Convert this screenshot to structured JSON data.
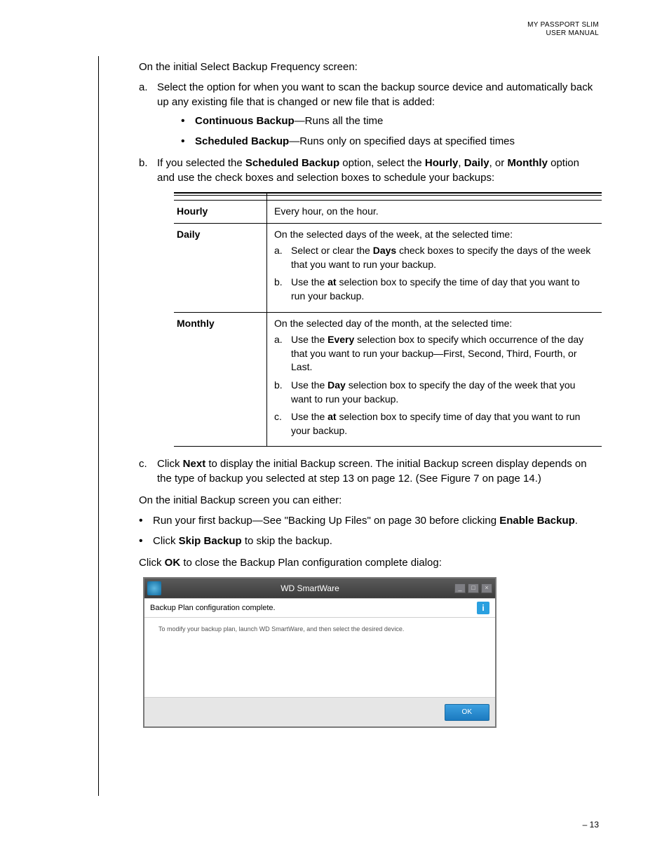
{
  "header": {
    "line1": "MY PASSPORT SLIM",
    "line2": "USER MANUAL"
  },
  "intro": "On the initial Select Backup Frequency screen:",
  "step_a": {
    "label": "a.",
    "text": "Select the option for when you want to scan the backup source device and automatically back up any existing file that is changed or new file that is added:",
    "bullets": [
      {
        "bold": "Continuous Backup",
        "rest": "—Runs all the time"
      },
      {
        "bold": "Scheduled Backup",
        "rest": "—Runs only on specified days at specified times"
      }
    ]
  },
  "step_b": {
    "label": "b.",
    "pre": "If you selected the ",
    "b1": "Scheduled Backup",
    "mid1": " option, select the ",
    "b2": "Hourly",
    "sep1": ", ",
    "b3": "Daily",
    "sep2": ", or ",
    "b4": "Monthly",
    "post": " option and use the check boxes and selection boxes to schedule your backups:"
  },
  "table": {
    "hourly": {
      "label": "Hourly",
      "desc": "Every hour, on the hour."
    },
    "daily": {
      "label": "Daily",
      "intro": "On the selected days of the week, at the selected time:",
      "a": {
        "label": "a.",
        "pre": "Select or clear the ",
        "b": "Days",
        "post": " check boxes to specify the days of the week that you want to run your backup."
      },
      "b": {
        "label": "b.",
        "pre": "Use the ",
        "b": "at",
        "post": " selection box to specify the time of day that you want to run your backup."
      }
    },
    "monthly": {
      "label": "Monthly",
      "intro": "On the selected day of the month, at the selected time:",
      "a": {
        "label": "a.",
        "pre": "Use the ",
        "b": "Every",
        "post": " selection box to specify which occurrence of the day that you want to run your backup—First, Second, Third, Fourth, or Last."
      },
      "b": {
        "label": "b.",
        "pre": "Use the ",
        "b": "Day",
        "post": " selection box to specify the day of the week that you want to run your backup."
      },
      "c": {
        "label": "c.",
        "pre": "Use the ",
        "b": "at",
        "post": " selection box to specify time of day that you want to run your backup."
      }
    }
  },
  "step_c": {
    "label": "c.",
    "pre": "Click ",
    "b1": "Next",
    "post": " to display the initial Backup screen. The initial Backup screen display depends on the type of backup you selected at step 13 on page 12. (See Figure 7 on page 14.)"
  },
  "post_intro": "On the initial Backup screen you can either:",
  "post_bullets": {
    "b1": {
      "pre": "Run your first backup—See \"Backing Up Files\" on page 30 before clicking ",
      "bold": "Enable Backup",
      "post": "."
    },
    "b2": {
      "pre": "Click ",
      "bold": "Skip Backup",
      "post": " to skip the backup."
    }
  },
  "close_line": {
    "pre": "Click ",
    "b": "OK",
    "post": " to close the Backup Plan configuration complete dialog:"
  },
  "dialog": {
    "title": "WD SmartWare",
    "message": "Backup Plan configuration complete.",
    "subtext": "To modify your backup plan, launch WD SmartWare, and then select the desired device.",
    "ok": "OK",
    "info": "i",
    "min": "_",
    "max": "□",
    "close": "×"
  },
  "page_number": "– 13"
}
